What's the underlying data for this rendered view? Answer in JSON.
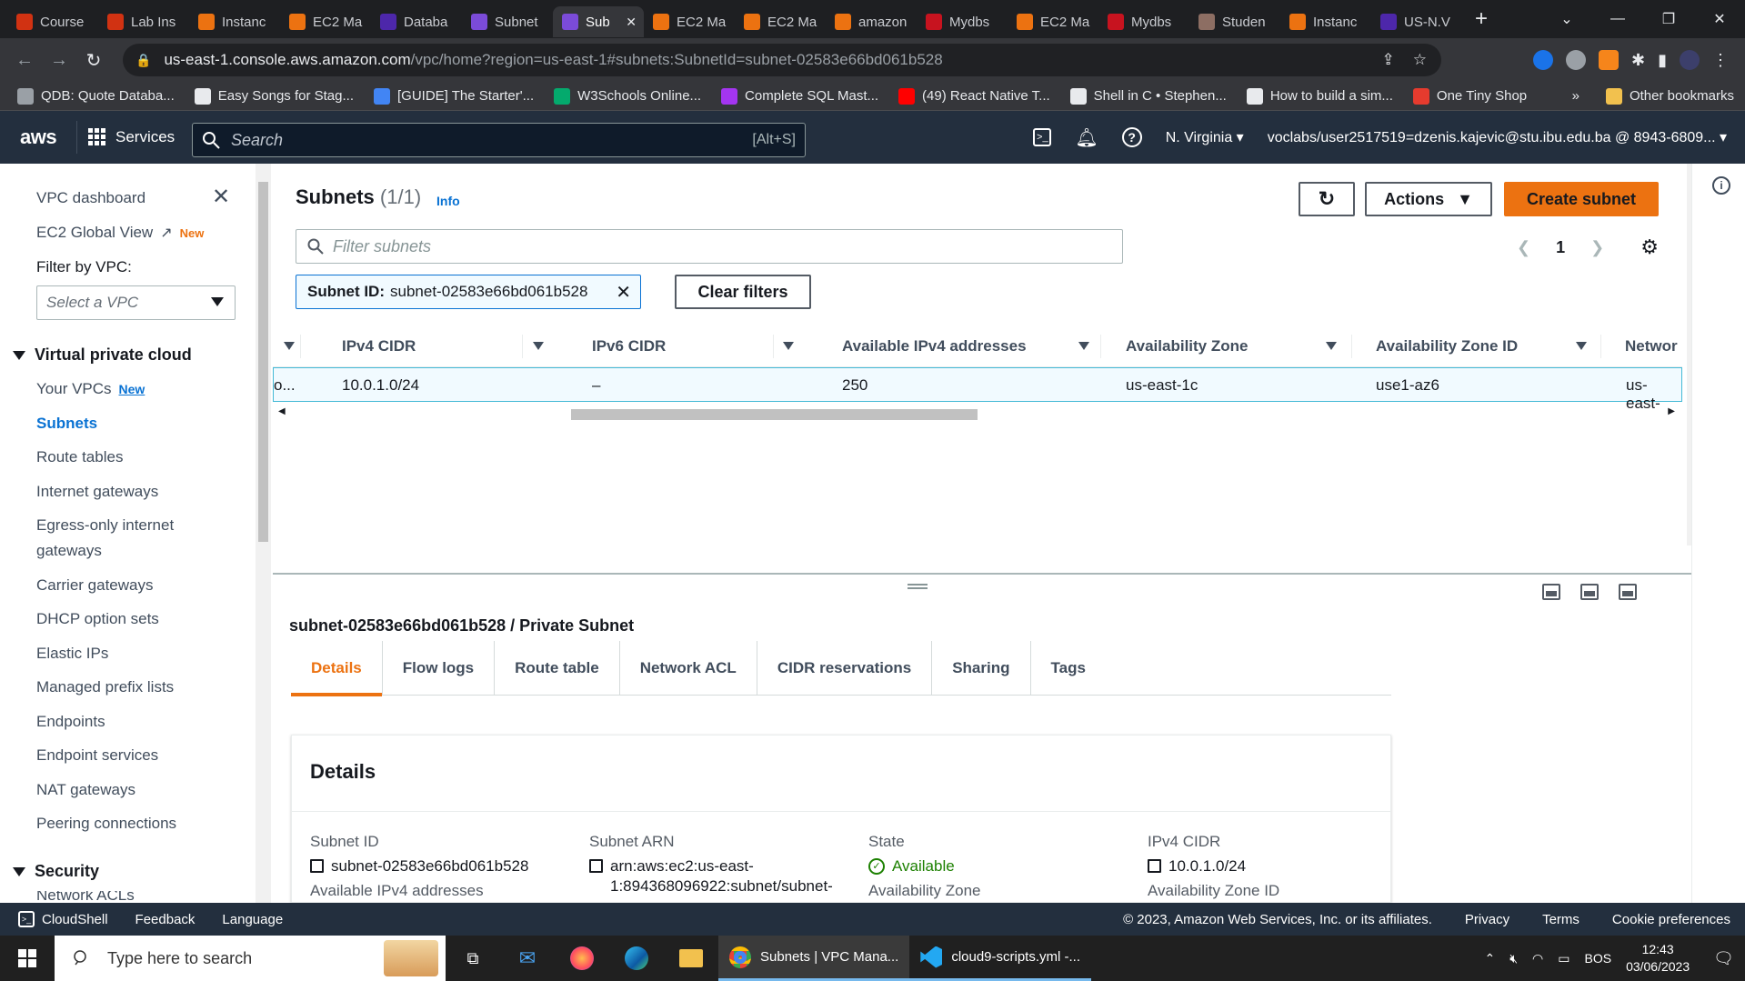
{
  "browser": {
    "tabs": [
      {
        "title": "Course",
        "color": "#d13212",
        "active": false
      },
      {
        "title": "Lab Ins",
        "color": "#d13212",
        "active": false
      },
      {
        "title": "Instanc",
        "color": "#ec7211",
        "active": false
      },
      {
        "title": "EC2 Ma",
        "color": "#ec7211",
        "active": false
      },
      {
        "title": "Databa",
        "color": "#4d27aa",
        "active": false
      },
      {
        "title": "Subnet",
        "color": "#7b4bd8",
        "active": false
      },
      {
        "title": "Sub",
        "color": "#7b4bd8",
        "active": true
      },
      {
        "title": "EC2 Ma",
        "color": "#ec7211",
        "active": false
      },
      {
        "title": "EC2 Ma",
        "color": "#ec7211",
        "active": false
      },
      {
        "title": "amazon",
        "color": "#ec7211",
        "active": false
      },
      {
        "title": "Mydbs",
        "color": "#c7131f",
        "active": false
      },
      {
        "title": "EC2 Ma",
        "color": "#ec7211",
        "active": false
      },
      {
        "title": "Mydbs",
        "color": "#c7131f",
        "active": false
      },
      {
        "title": "Studen",
        "color": "#8d6e63",
        "active": false
      },
      {
        "title": "Instanc",
        "color": "#ec7211",
        "active": false
      },
      {
        "title": "US-N.V",
        "color": "#4d27aa",
        "active": false
      }
    ],
    "url_host": "us-east-1.console.aws.amazon.com",
    "url_path": "/vpc/home?region=us-east-1#subnets:SubnetId=subnet-02583e66bd061b528",
    "bookmarks": [
      {
        "label": "QDB: Quote Databa...",
        "color": "#9aa0a6"
      },
      {
        "label": "Easy Songs for Stag...",
        "color": "#e8eaed"
      },
      {
        "label": "[GUIDE] The Starter'...",
        "color": "#4285f4"
      },
      {
        "label": "W3Schools Online...",
        "color": "#04aa6d"
      },
      {
        "label": "Complete SQL Mast...",
        "color": "#a435f0"
      },
      {
        "label": "(49) React Native T...",
        "color": "#ff0000"
      },
      {
        "label": "Shell in C • Stephen...",
        "color": "#e8eaed"
      },
      {
        "label": "How to build a sim...",
        "color": "#e8eaed"
      },
      {
        "label": "One Tiny Shop",
        "color": "#e63b2e"
      }
    ],
    "other_bookmarks": "Other bookmarks"
  },
  "aws": {
    "logo": "aws",
    "services": "Services",
    "search_placeholder": "Search",
    "search_shortcut": "[Alt+S]",
    "region": "N. Virginia",
    "account": "voclabs/user2517519=dzenis.kajevic@stu.ibu.edu.ba @ 8943-6809..."
  },
  "sidebar": {
    "dashboard": "VPC dashboard",
    "global_view": "EC2 Global View",
    "new_badge": "New",
    "filter_label": "Filter by VPC:",
    "vpc_placeholder": "Select a VPC",
    "section_vpc": "Virtual private cloud",
    "items": [
      "Your VPCs",
      "Subnets",
      "Route tables",
      "Internet gateways",
      "Egress-only internet",
      "gateways",
      "Carrier gateways",
      "DHCP option sets",
      "Elastic IPs",
      "Managed prefix lists",
      "Endpoints",
      "Endpoint services",
      "NAT gateways",
      "Peering connections"
    ],
    "section_security": "Security",
    "security_partial": "Network ACLs"
  },
  "main": {
    "title": "Subnets",
    "count": "(1/1)",
    "info": "Info",
    "actions": "Actions",
    "create": "Create subnet",
    "filter_placeholder": "Filter subnets",
    "token_key": "Subnet ID:",
    "token_value": "subnet-02583e66bd061b528",
    "clear_filters": "Clear filters",
    "page": "1",
    "columns": [
      "IPv4 CIDR",
      "IPv6 CIDR",
      "Available IPv4 addresses",
      "Availability Zone",
      "Availability Zone ID",
      "Networ"
    ],
    "row": {
      "lead": "o...",
      "ipv4": "10.0.1.0/24",
      "ipv6": "–",
      "available": "250",
      "az": "us-east-1c",
      "azid": "use1-az6",
      "net": "us-east-"
    }
  },
  "details": {
    "title": "subnet-02583e66bd061b528 / Private Subnet",
    "tabs": [
      "Details",
      "Flow logs",
      "Route table",
      "Network ACL",
      "CIDR reservations",
      "Sharing",
      "Tags"
    ],
    "panel_title": "Details",
    "subnet_id_label": "Subnet ID",
    "subnet_id": "subnet-02583e66bd061b528",
    "arn_label": "Subnet ARN",
    "arn_line1": "arn:aws:ec2:us-east-",
    "arn_line2": "1:894368096922:subnet/subnet-",
    "state_label": "State",
    "state": "Available",
    "cidr_label": "IPv4 CIDR",
    "cidr": "10.0.1.0/24",
    "available_label": "Available IPv4 addresses",
    "az_label": "Availability Zone",
    "azid_label": "Availability Zone ID"
  },
  "footer": {
    "cloudshell": "CloudShell",
    "feedback": "Feedback",
    "language": "Language",
    "copyright": "© 2023, Amazon Web Services, Inc. or its affiliates.",
    "privacy": "Privacy",
    "terms": "Terms",
    "cookies": "Cookie preferences"
  },
  "taskbar": {
    "search": "Type here to search",
    "chrome_app": "Subnets | VPC Mana...",
    "vscode_app": "cloud9-scripts.yml -...",
    "lang": "BOS",
    "time": "12:43",
    "date": "03/06/2023"
  }
}
